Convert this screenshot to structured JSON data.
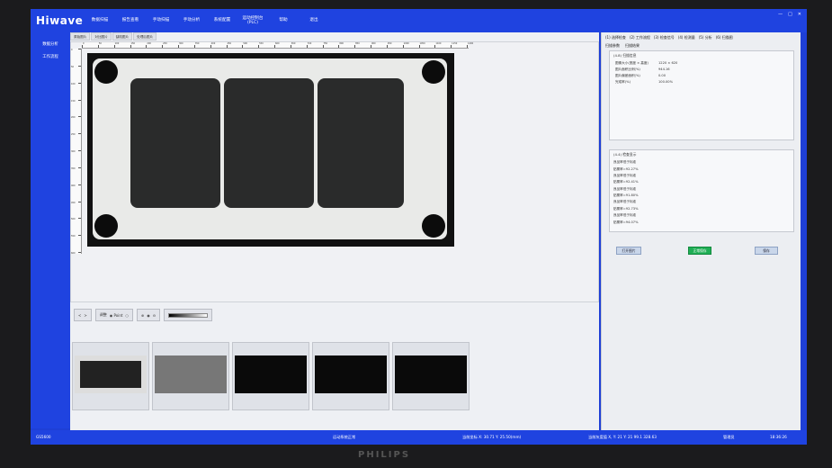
{
  "app": {
    "logo": "Hiwave",
    "model": "GS5600"
  },
  "menu": [
    "数据扫描",
    "报告查看",
    "手动扫描",
    "手动分析",
    "系统配置",
    "运动控制台(PLC)",
    "帮助",
    "退出"
  ],
  "window_controls": [
    "—",
    "□",
    "✕"
  ],
  "leftnav": [
    "数据分析",
    "工作流程"
  ],
  "image_tabs": [
    "原始图片",
    "对比图片",
    "缺陷图片",
    "处理后图片"
  ],
  "ruler": {
    "x_ticks": [
      "0",
      "50",
      "100",
      "150",
      "200",
      "250",
      "300",
      "350",
      "400",
      "450",
      "500",
      "550",
      "600",
      "650",
      "700",
      "750",
      "800",
      "850",
      "900",
      "950",
      "1000",
      "1050",
      "1100",
      "1150",
      "1200"
    ],
    "y_ticks": [
      "0",
      "50",
      "100",
      "150",
      "200",
      "250",
      "300",
      "350",
      "400",
      "450",
      "500",
      "550",
      "600"
    ]
  },
  "tools": {
    "nav_prev": "<",
    "nav_next": ">",
    "mode_label": "调整",
    "radio_point": "Point",
    "radio_line": "",
    "zoom_in": "+",
    "zoom_out": "-",
    "gray_label": "灰度"
  },
  "thumbnails": [
    "原图",
    "增强图",
    "轮廓图",
    "分区图",
    "缺陷图"
  ],
  "right": {
    "tabs": [
      "(1) 选择检查",
      "(2) 工作流程",
      "(3) 检查信号",
      "(4) 检测量",
      "(5) 分析",
      "(6) 扫描图"
    ],
    "subtabs": [
      "扫描参数",
      "扫描结果"
    ],
    "scan_info": {
      "title": "(4.8) 扫描信息",
      "rows": [
        {
          "k": "图像大小(宽度 × 高度)",
          "v": "1220 × 620"
        },
        {
          "k": "图片面积比例(%)",
          "v": "944.16"
        },
        {
          "k": "图片偏差面积(%)",
          "v": "0.00"
        },
        {
          "k": "完成率(%)",
          "v": "100.00%"
        }
      ]
    },
    "results": {
      "title": "(4.4) 检查显示",
      "lines": [
        "良品率低于标准",
        "贴覆率=92.27%",
        "良品率低于标准",
        "贴覆率=92.41%",
        "良品率低于标准",
        "贴覆率=91.80%",
        "良品率低于标准",
        "贴覆率=92.73%",
        "良品率低于标准",
        "贴覆率=94.07%"
      ]
    },
    "buttons": {
      "open_image": "打开图片",
      "ok": "正常保存",
      "save": "保存"
    },
    "bottom_buttons": {
      "prev": "上一步",
      "confirm": "确保",
      "next": "保存"
    }
  },
  "status": {
    "left": "GS5600",
    "middle": "运动系统正常",
    "coords": "当前坐标  X: 30.71  Y: 25.50(mm)",
    "gray": "当前灰度值  X, Y: 21  Y: 21  99.1  328.63",
    "user": "管理员",
    "time": "18:36:26"
  },
  "colors": {
    "chrome": "#1f43e0",
    "panel": "#eceef2",
    "accent_green": "#1fae55"
  },
  "monitor_brand": "PHILIPS"
}
